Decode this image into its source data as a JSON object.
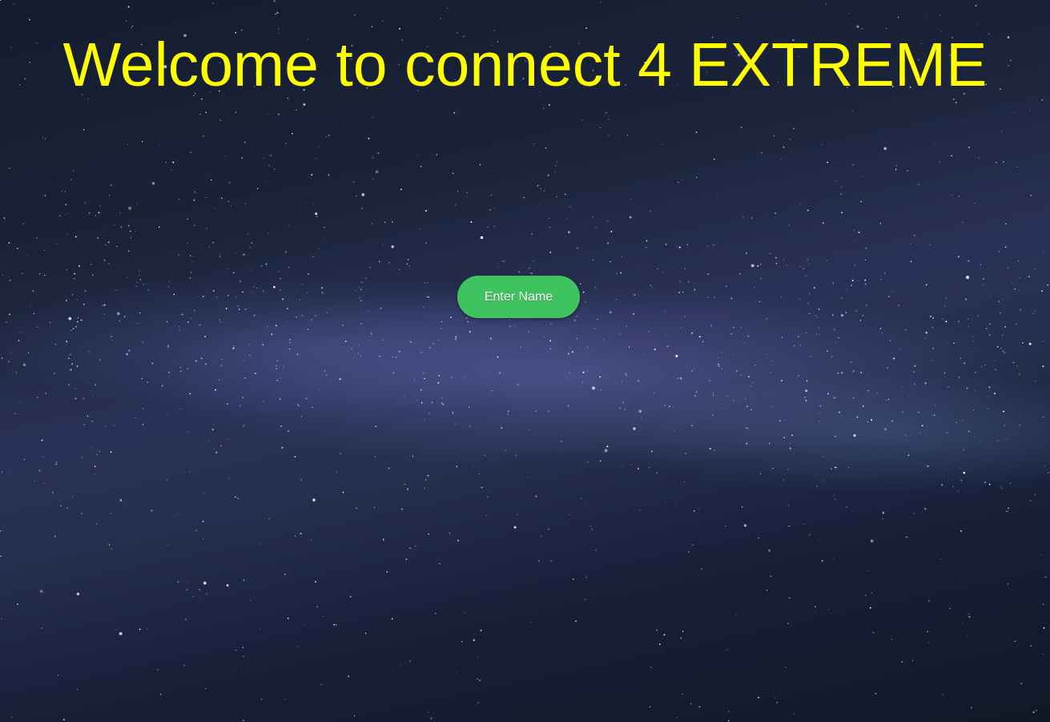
{
  "page": {
    "title": "Welcome to connect 4 EXTREME",
    "enter_name_button": "Enter Name"
  },
  "colors": {
    "title": "#ffff00",
    "button": "#3fc35f",
    "button_text": "#ffffff"
  }
}
